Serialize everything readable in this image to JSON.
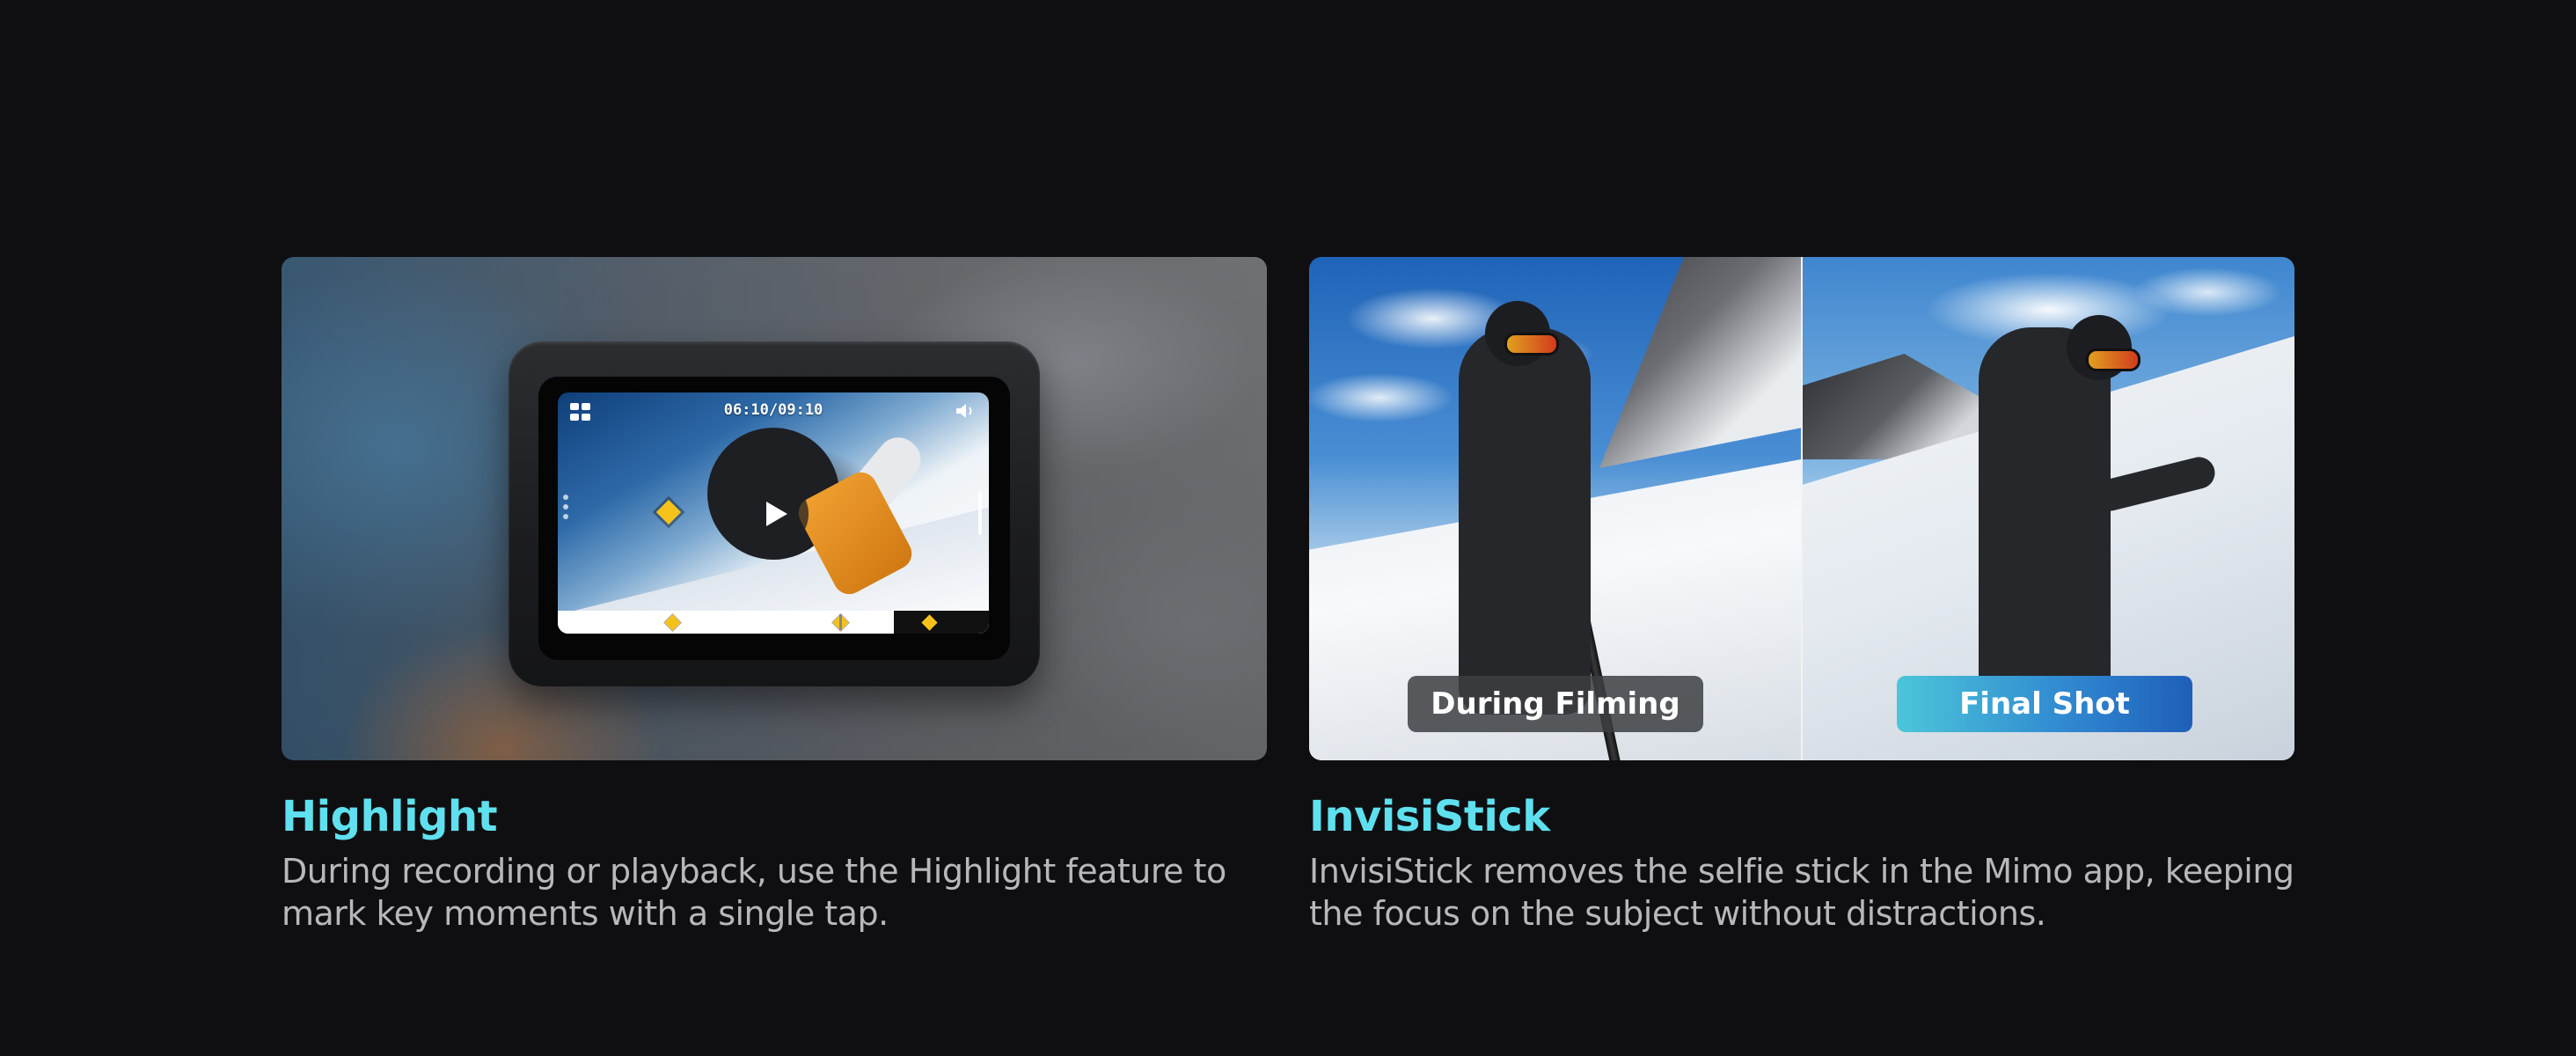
{
  "features": [
    {
      "title": "Highlight",
      "description": "During recording or playback, use the Highlight feature to mark key moments with a single tap.",
      "media": {
        "screen_time": "06:10/09:10",
        "icons": [
          "grid-menu-icon",
          "volume-icon",
          "play-icon",
          "highlight-marker-icon"
        ]
      }
    },
    {
      "title": "InvisiStick",
      "description": "InvisiStick removes the selfie stick in the Mimo app, keeping the focus on the subject without distractions.",
      "media": {
        "left_label": "During Filming",
        "right_label": "Final Shot"
      }
    }
  ],
  "colors": {
    "background": "#0f0f12",
    "title_accent": "#5fe0ee",
    "description_text": "#b7b8bb",
    "highlight_marker": "#f4c21b",
    "final_shot_badge": "#2f86d0"
  }
}
